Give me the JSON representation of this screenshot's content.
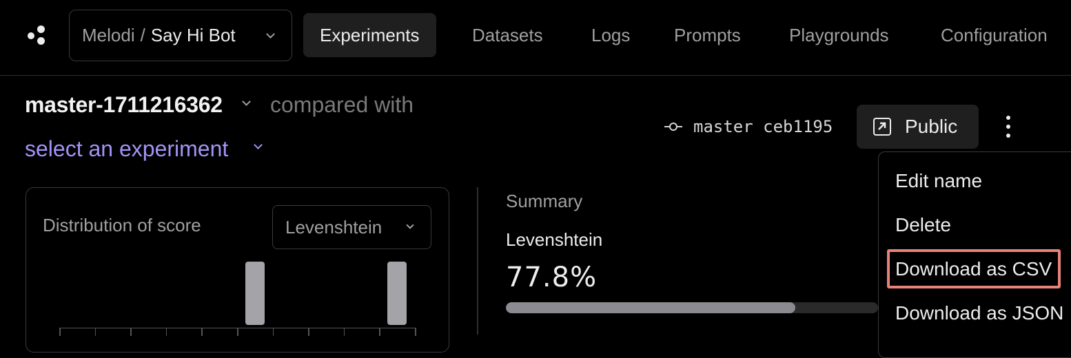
{
  "header": {
    "project_switcher": {
      "org": "Melodi",
      "separator": "/",
      "project": "Say Hi Bot"
    },
    "nav_tabs": [
      {
        "label": "Experiments",
        "active": true
      },
      {
        "label": "Datasets",
        "active": false
      },
      {
        "label": "Logs",
        "active": false
      },
      {
        "label": "Prompts",
        "active": false
      },
      {
        "label": "Playgrounds",
        "active": false
      },
      {
        "label": "Configuration",
        "active": false
      }
    ]
  },
  "experiment": {
    "name": "master-1711216362",
    "compared_with": "compared with",
    "select_prompt": "select an experiment",
    "branch_label": "master ceb1195",
    "visibility_button": "Public"
  },
  "actions_menu": {
    "items": [
      "Edit name",
      "Delete",
      "Download as CSV",
      "Download as JSON"
    ],
    "highlighted_item": "Download as CSV"
  },
  "distribution": {
    "label": "Distribution of score",
    "scorer_select": "Levenshtein",
    "bins": 10,
    "bar_bins": [
      5,
      9
    ],
    "bar_color": "#a3a3a8"
  },
  "summary": {
    "label": "Summary",
    "metric_name": "Levenshtein",
    "metric_value": "77.8%",
    "metric_fraction": 0.778
  },
  "colors": {
    "background": "#000000",
    "accent_purple": "#a493f5",
    "highlight_outline": "#e8837a"
  }
}
